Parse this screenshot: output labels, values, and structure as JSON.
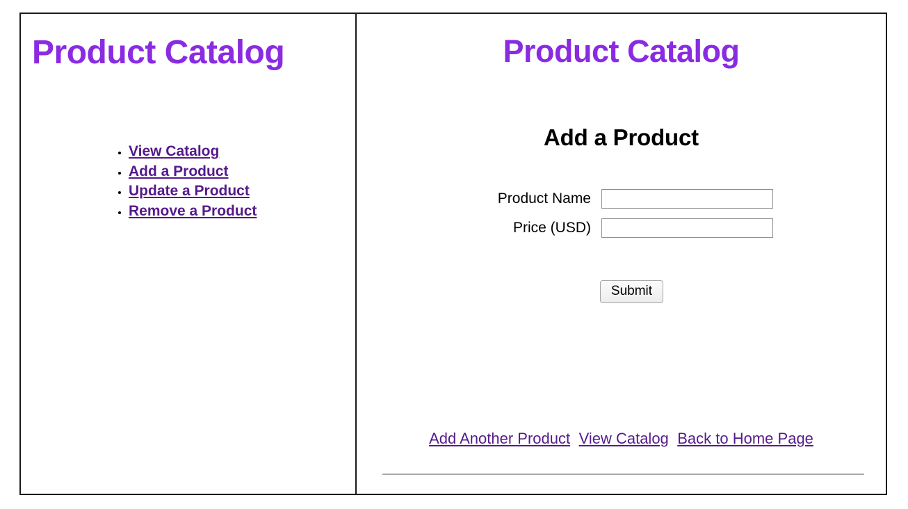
{
  "left_panel": {
    "title": "Product Catalog",
    "nav_items": [
      {
        "label": "View Catalog"
      },
      {
        "label": "Add a Product"
      },
      {
        "label": "Update a Product"
      },
      {
        "label": "Remove a Product"
      }
    ]
  },
  "right_panel": {
    "title": "Product Catalog",
    "section_heading": "Add a Product",
    "form": {
      "fields": [
        {
          "label": "Product Name",
          "value": "",
          "placeholder": ""
        },
        {
          "label": "Price (USD)",
          "value": "",
          "placeholder": ""
        }
      ],
      "submit_label": "Submit"
    },
    "footer_links": [
      {
        "label": "Add Another Product"
      },
      {
        "label": "View Catalog"
      },
      {
        "label": "Back to Home Page"
      }
    ]
  },
  "colors": {
    "heading_purple": "#8A2BE2",
    "link_purple": "#551A8B",
    "frame_border": "#1a1a1a",
    "input_border": "#8f8f8f",
    "rule_gray": "#a9a9a9"
  }
}
